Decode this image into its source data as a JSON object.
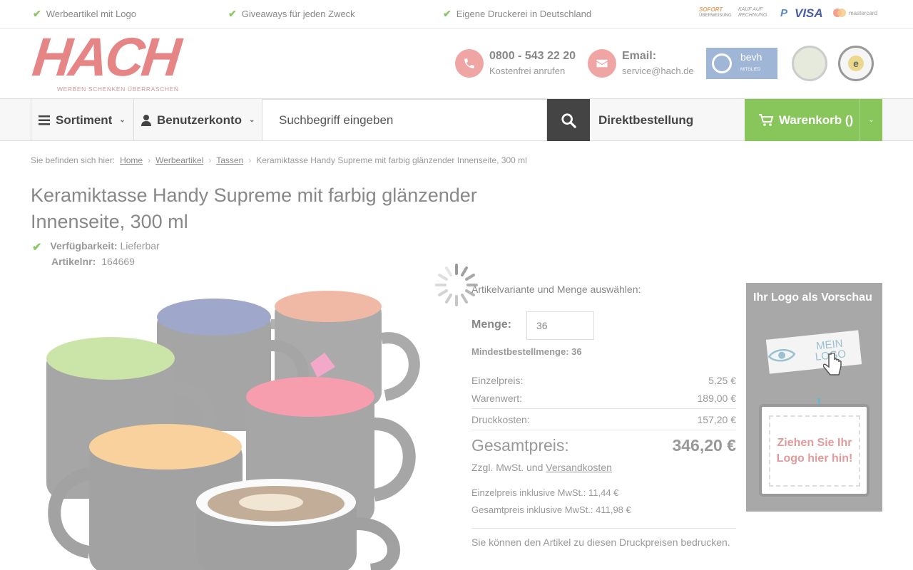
{
  "usp": [
    "Werbeartikel mit Logo",
    "Giveaways für jeden Zweck",
    "Eigene Druckerei in Deutschland"
  ],
  "payments": {
    "sofort": "SOFORT",
    "sofort_sub": "ÜBERWEISUNG",
    "kauf": "KAUF AUF",
    "rechnung": "RECHNUNG",
    "paypal": "P",
    "visa": "VISA",
    "mastercard": "mastercard"
  },
  "logo": {
    "name": "HACH",
    "tagline": "WERBEN  SCHENKEN  ÜBERRASCHEN"
  },
  "contact": {
    "phone": "0800 - 543 22 20",
    "phone_sub": "Kostenfrei anrufen",
    "email_label": "Email:",
    "email": "service@hach.de"
  },
  "badges": {
    "bevh": "bevh",
    "bevh_sub": "MITGLIED"
  },
  "nav": {
    "sortiment": "Sortiment",
    "account": "Benutzerkonto",
    "search_placeholder": "Suchbegriff eingeben",
    "direkt": "Direktbestellung",
    "cart": "Warenkorb ()"
  },
  "breadcrumb": {
    "prefix": "Sie befinden sich hier:",
    "items": [
      "Home",
      "Werbeartikel",
      "Tassen"
    ],
    "current": "Keramiktasse Handy Supreme mit farbig glänzender Innenseite, 300 ml"
  },
  "product": {
    "title": "Keramiktasse Handy Supreme mit farbig glänzender Innenseite, 300 ml",
    "availability_label": "Verfügbarkeit:",
    "availability": "Lieferbar",
    "artnr_label": "Artikelnr:",
    "artnr": "164669"
  },
  "order": {
    "variant_label": "Artikelvariante und Menge auswählen:",
    "menge_label": "Menge:",
    "menge_value": "36",
    "min_order": "Mindestbestellmenge: 36",
    "rows": [
      {
        "label": "Einzelpreis:",
        "value": "5,25 €"
      },
      {
        "label": "Warenwert:",
        "value": "189,00 €"
      },
      {
        "label": "Druckkosten:",
        "value": "157,20 €"
      }
    ],
    "total_label": "Gesamtpreis:",
    "total_value": "346,20 €",
    "tax_note": "Zzgl. MwSt. und",
    "shipping_link": "Versandkosten",
    "inkl_single": "Einzelpreis inklusive MwSt.: 11,44 €",
    "inkl_total": "Gesamtpreis inklusive MwSt.: 411,98 €",
    "print_note": "Sie können den Artikel zu diesen Druckpreisen bedrucken."
  },
  "logo_preview": {
    "title": "Ihr Logo als Vorschau",
    "mein_logo": "MEIN LOGO",
    "drop_text": "Ziehen Sie Ihr Logo hier hin!"
  },
  "colors": {
    "accent_green": "#88c65c",
    "brand_red": "#e58585"
  }
}
